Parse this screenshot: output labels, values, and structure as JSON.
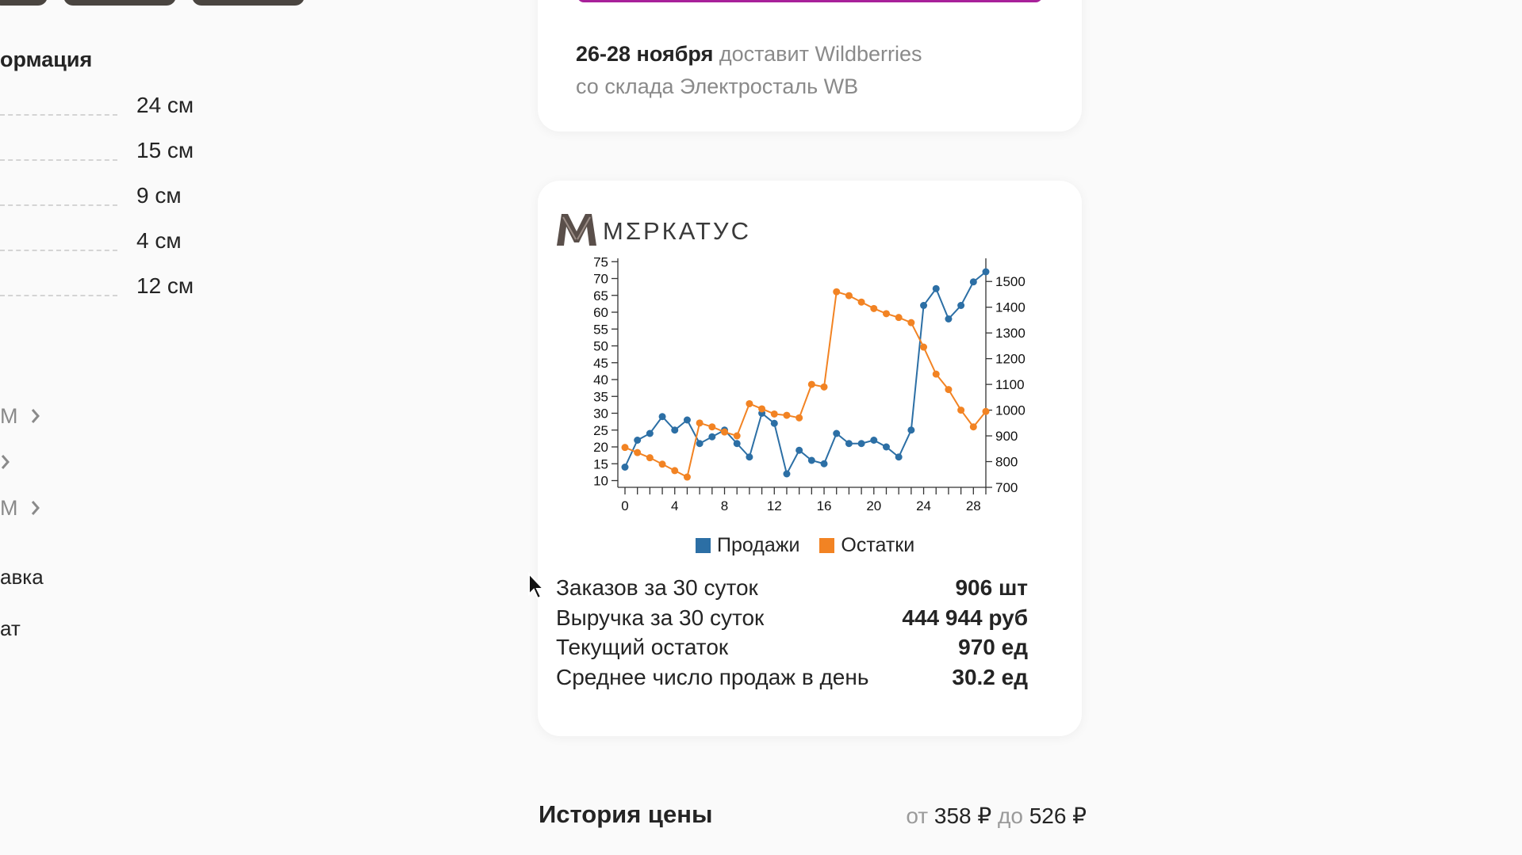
{
  "info": {
    "title": "ормация",
    "specs": [
      "24 см",
      "15 см",
      "9 см",
      "4 см",
      "12 см"
    ],
    "links": [
      "М",
      "",
      "М"
    ],
    "items": [
      "авка",
      "ат"
    ]
  },
  "delivery": {
    "date": "26-28 ноября",
    "line1_rest": " доставит Wildberries",
    "line2": "со склада Электросталь WB",
    "accent_color": "#a8219a"
  },
  "widget": {
    "brand_name": "МΣРКАТУС",
    "legend": {
      "sales": "Продажи",
      "stock": "Остатки"
    },
    "stats": [
      {
        "label": "Заказов за 30 суток",
        "value": "906 шт"
      },
      {
        "label": "Выручка за 30 суток",
        "value": "444 944 руб"
      },
      {
        "label": "Текущий остаток",
        "value": "970 ед"
      },
      {
        "label": "Среднее число продаж в день",
        "value": "30.2 ед"
      }
    ]
  },
  "price_history": {
    "title": "История цены",
    "from_word": "от",
    "min_price": "358 ₽",
    "to_word": "до",
    "max_price": "526 ₽"
  },
  "chart_data": {
    "type": "line",
    "x": [
      0,
      1,
      2,
      3,
      4,
      5,
      6,
      7,
      8,
      9,
      10,
      11,
      12,
      13,
      14,
      15,
      16,
      17,
      18,
      19,
      20,
      21,
      22,
      23,
      24,
      25,
      26,
      27,
      28,
      29
    ],
    "x_ticks": [
      0,
      4,
      8,
      12,
      16,
      20,
      24,
      28
    ],
    "y_left": {
      "range": [
        8,
        76
      ],
      "ticks": [
        10,
        15,
        20,
        25,
        30,
        35,
        40,
        45,
        50,
        55,
        60,
        65,
        70,
        75
      ]
    },
    "y_right": {
      "range": [
        700,
        1590
      ],
      "ticks": [
        700,
        800,
        900,
        1000,
        1100,
        1200,
        1300,
        1400,
        1500
      ]
    },
    "series": [
      {
        "name": "Продажи",
        "axis": "left",
        "color": "#2c6fa5",
        "values": [
          14,
          22,
          24,
          29,
          25,
          28,
          21,
          23,
          25,
          21,
          17,
          30,
          27,
          12,
          19,
          16,
          15,
          24,
          21,
          21,
          22,
          20,
          17,
          25,
          62,
          67,
          58,
          62,
          69,
          72
        ]
      },
      {
        "name": "Остатки",
        "axis": "right",
        "color": "#f28323",
        "values": [
          855,
          835,
          815,
          790,
          765,
          740,
          950,
          935,
          915,
          900,
          1025,
          1005,
          985,
          980,
          970,
          1100,
          1090,
          1460,
          1445,
          1420,
          1395,
          1375,
          1360,
          1340,
          1245,
          1140,
          1080,
          1000,
          935,
          995
        ]
      }
    ],
    "legend_position": "bottom-center",
    "grid": false
  }
}
